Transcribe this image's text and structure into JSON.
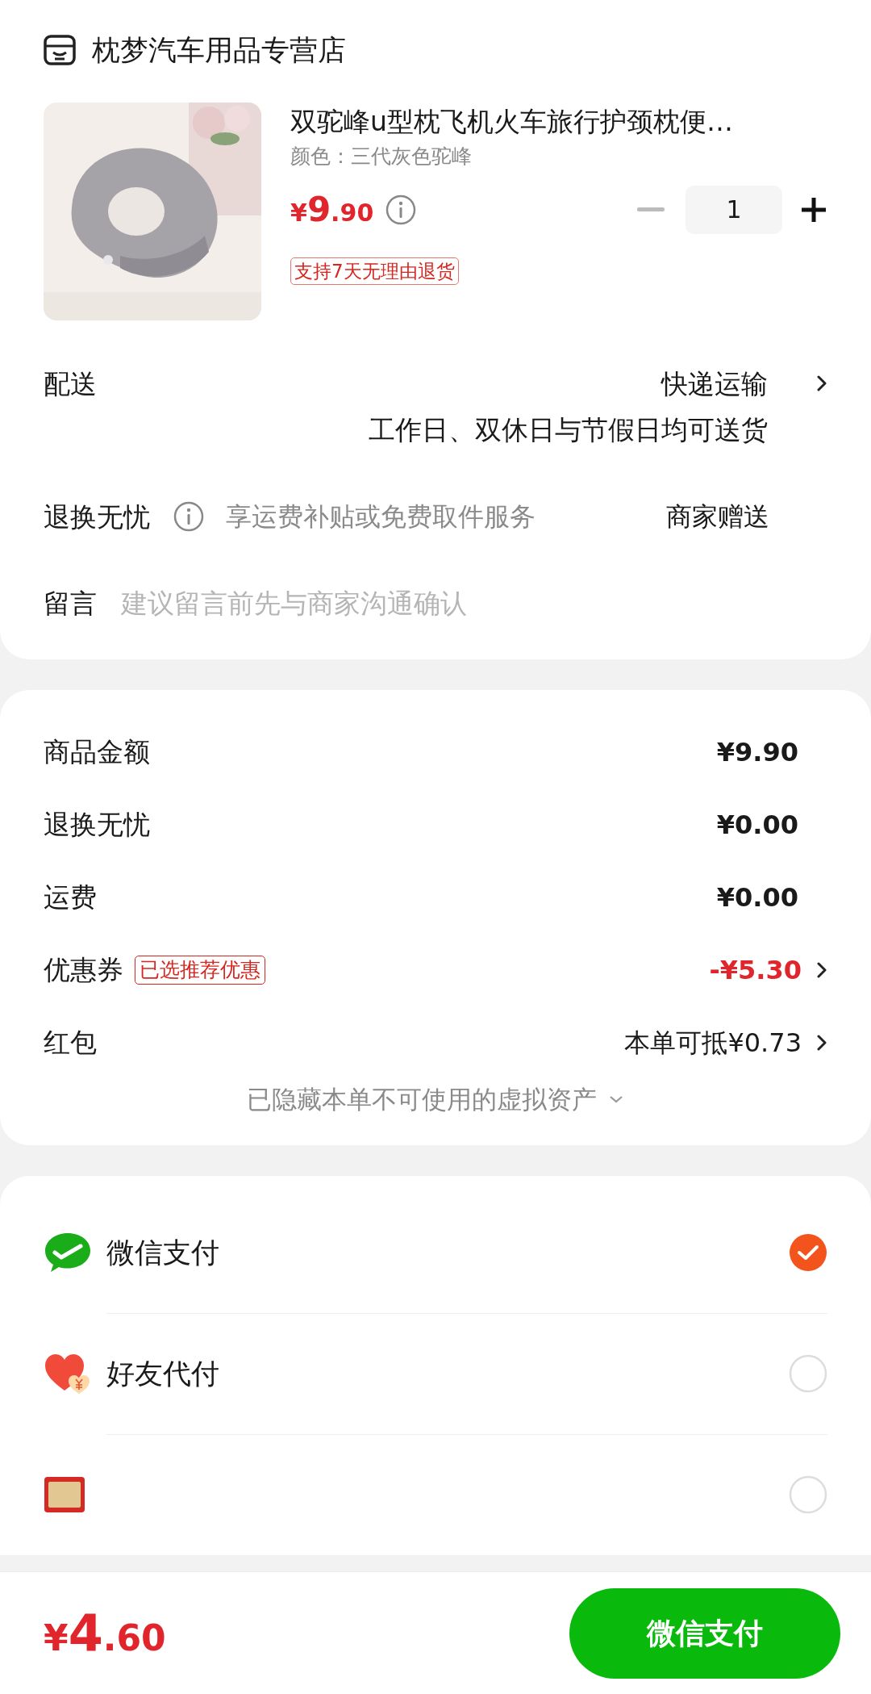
{
  "store": {
    "name": "枕梦汽车用品专营店"
  },
  "product": {
    "title": "双驼峰u型枕飞机火车旅行护颈枕便…",
    "spec": "颜色：三代灰色驼峰",
    "price_symbol": "¥",
    "price_int": "9",
    "price_dec": ".90",
    "quantity": "1",
    "tag": "支持7天无理由退货"
  },
  "delivery": {
    "label": "配送",
    "method": "快递运输",
    "note": "工作日、双休日与节假日均可送货"
  },
  "returns": {
    "label": "退换无忧",
    "description": "享运费补贴或免费取件服务",
    "provider": "商家赠送"
  },
  "message": {
    "label": "留言",
    "placeholder": "建议留言前先与商家沟通确认"
  },
  "summary": {
    "rows": [
      {
        "kind": "plain",
        "label": "商品金额",
        "value": "¥9.90"
      },
      {
        "kind": "plain",
        "label": "退换无忧",
        "value": "¥0.00"
      },
      {
        "kind": "plain",
        "label": "运费",
        "value": "¥0.00"
      },
      {
        "kind": "coupon",
        "label": "优惠券",
        "badge": "已选推荐优惠",
        "value": "-¥5.30"
      },
      {
        "kind": "link",
        "label": "红包",
        "value": "本单可抵¥0.73"
      }
    ],
    "hidden_note": "已隐藏本单不可使用的虚拟资产"
  },
  "payment_methods": [
    {
      "kind": "wechat",
      "label": "微信支付",
      "selected": true
    },
    {
      "kind": "friend",
      "label": "好友代付",
      "selected": false
    },
    {
      "kind": "card",
      "selected": false
    }
  ],
  "bottom_bar": {
    "total_symbol": "¥",
    "total_int": "4",
    "total_dec": ".60",
    "button": "微信支付"
  }
}
